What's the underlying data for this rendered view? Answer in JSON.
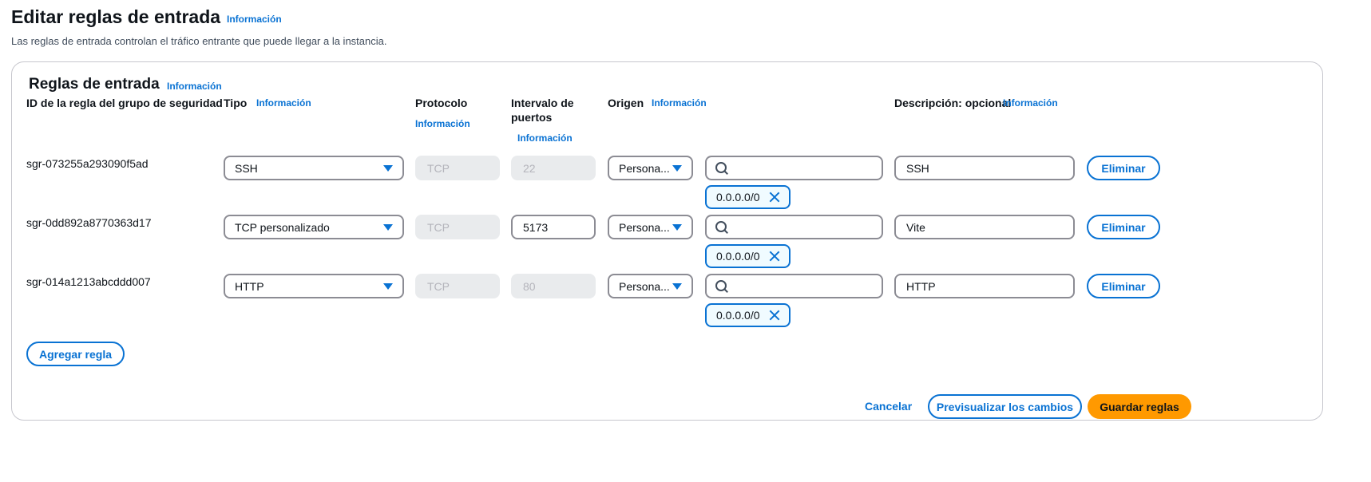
{
  "header": {
    "title": "Editar reglas de entrada",
    "info": "Información",
    "description": "Las reglas de entrada controlan el tráfico entrante que puede llegar a la instancia."
  },
  "panel": {
    "title": "Reglas de entrada",
    "info": "Información",
    "columns": {
      "rule_id": "ID de la regla del grupo de seguridad",
      "type": "Tipo",
      "type_info": "Información",
      "protocol": "Protocolo",
      "protocol_info": "Información",
      "port_range_1": "Intervalo de",
      "port_range_2": "puertos",
      "port_range_info": "Información",
      "source": "Origen",
      "source_info": "Información",
      "description": "Descripción: opcional",
      "description_info": "Información"
    },
    "rules": [
      {
        "id": "sgr-073255a293090f5ad",
        "type": "SSH",
        "protocol": "TCP",
        "port": "22",
        "port_editable": false,
        "source": "Persona...",
        "source_search": "",
        "cidr": "0.0.0.0/0",
        "description": "SSH",
        "delete": "Eliminar"
      },
      {
        "id": "sgr-0dd892a8770363d17",
        "type": "TCP personalizado",
        "protocol": "TCP",
        "port": "5173",
        "port_editable": true,
        "source": "Persona...",
        "source_search": "",
        "cidr": "0.0.0.0/0",
        "description": "Vite",
        "delete": "Eliminar"
      },
      {
        "id": "sgr-014a1213abcddd007",
        "type": "HTTP",
        "protocol": "TCP",
        "port": "80",
        "port_editable": false,
        "source": "Persona...",
        "source_search": "",
        "cidr": "0.0.0.0/0",
        "description": "HTTP",
        "delete": "Eliminar"
      }
    ],
    "add_rule": "Agregar regla"
  },
  "footer": {
    "cancel": "Cancelar",
    "preview": "Previsualizar los cambios",
    "save": "Guardar reglas"
  },
  "colors": {
    "link": "#0972d3",
    "primary": "#ff9900",
    "border": "#8c8c94",
    "disabled_bg": "#e9ebed"
  }
}
